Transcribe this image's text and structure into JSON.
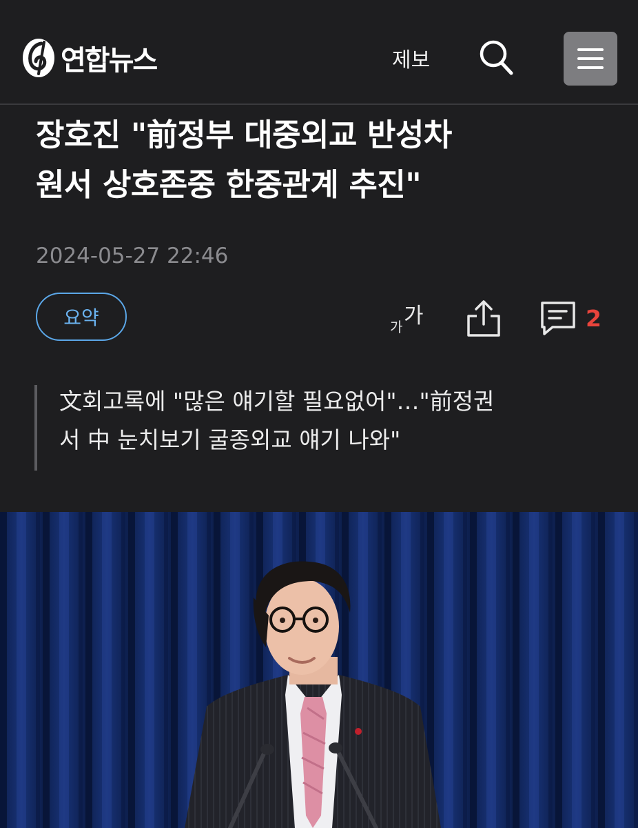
{
  "header": {
    "logo_text": "연합뉴스",
    "tip_label": "제보",
    "icons": {
      "search": "search-icon",
      "menu": "hamburger-menu-icon",
      "logo": "yonhap-logo-icon"
    }
  },
  "article": {
    "headline_line1": "장호진 \"前정부 대중외교 반성차",
    "headline_line2": "원서 상호존중 한중관계 추진\"",
    "date": "2024-05-27 22:46",
    "summary_button": "요약",
    "font_size_big": "가",
    "font_size_small": "가",
    "comment_count": "2",
    "subtitle_line1": "文회고록에 \"많은 얘기할 필요없어\"…\"前정권",
    "subtitle_line2": "서 中 눈치보기 굴종외교 얘기 나와\""
  },
  "colors": {
    "background": "#1e1e20",
    "accent_blue": "#5ba7e8",
    "comment_red": "#e9443c",
    "date_gray": "#8b8b8f"
  }
}
